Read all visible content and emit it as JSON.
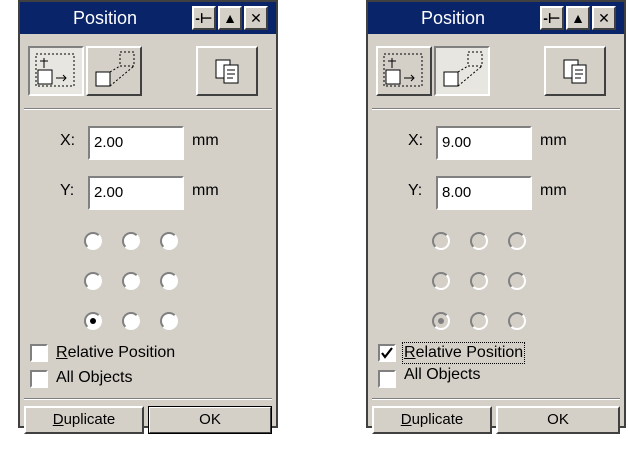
{
  "panels": [
    {
      "title": "Position",
      "title_buttons": [
        "-⊢",
        "▲",
        "✕"
      ],
      "x_label": "X:",
      "x_value": "2.00",
      "y_label": "Y:",
      "y_value": "2.00",
      "unit": "mm",
      "anchor_selected": "bottom-left",
      "anchors_enabled": true,
      "relative_position_prefix": "R",
      "relative_position_rest": "elative Position",
      "relative_position_checked": false,
      "all_objects_label": "All Objects",
      "all_objects_checked": false,
      "duplicate_prefix": "D",
      "duplicate_rest": "uplicate",
      "ok_label": "OK"
    },
    {
      "title": "Position",
      "title_buttons": [
        "-⊢",
        "▲",
        "✕"
      ],
      "x_label": "X:",
      "x_value": "9.00",
      "y_label": "Y:",
      "y_value": "8.00",
      "unit": "mm",
      "anchor_selected": "bottom-left",
      "anchors_enabled": false,
      "relative_position_prefix": "R",
      "relative_position_rest": "elative Position",
      "relative_position_checked": true,
      "all_objects_label": "All Objects",
      "all_objects_checked": false,
      "duplicate_prefix": "D",
      "duplicate_rest": "uplicate",
      "ok_label": "OK"
    }
  ]
}
